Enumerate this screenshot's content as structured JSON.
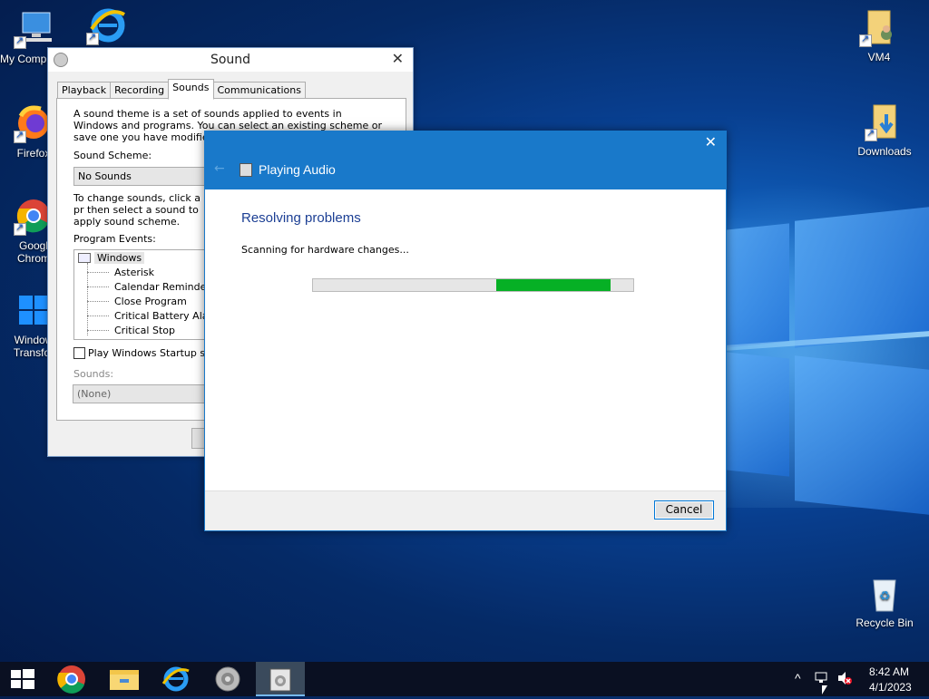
{
  "desktop": {
    "icons": [
      {
        "label": "My Comp",
        "icon": "computer-icon"
      },
      {
        "label": "",
        "icon": "internet-explorer-icon"
      },
      {
        "label": "Firefox",
        "icon": "firefox-icon"
      },
      {
        "label": "Googl\nChrom",
        "icon": "chrome-icon"
      },
      {
        "label": "Window\nTransfor",
        "icon": "windows-logo-icon"
      },
      {
        "label": "VM4",
        "icon": "user-folder-icon"
      },
      {
        "label": "Downloads",
        "icon": "downloads-folder-icon"
      },
      {
        "label": "Recycle Bin",
        "icon": "recycle-bin-icon"
      }
    ]
  },
  "sound_dialog": {
    "title": "Sound",
    "tabs": [
      "Playback",
      "Recording",
      "Sounds",
      "Communications"
    ],
    "active_tab": "Sounds",
    "intro": "A sound theme is a set of sounds applied to events in Windows and programs.  You can select an existing scheme or save one you have modified.",
    "scheme_label": "Sound Scheme:",
    "scheme_value": "No Sounds",
    "change_text": "To change sounds, click a pr then select a sound to apply sound scheme.",
    "events_label": "Program Events:",
    "events_root": "Windows",
    "events": [
      "Asterisk",
      "Calendar Reminder",
      "Close Program",
      "Critical Battery Alarm",
      "Critical Stop"
    ],
    "startup_label": "Play Windows Startup so",
    "sounds_label": "Sounds:",
    "sounds_value": "(None)"
  },
  "troubleshooter": {
    "title": "Playing Audio",
    "heading": "Resolving problems",
    "status": "Scanning for hardware changes...",
    "cancel_label": "Cancel",
    "progress_color": "#06b025"
  },
  "taskbar": {
    "items": [
      "start-icon",
      "chrome-icon",
      "file-explorer-icon",
      "internet-explorer-icon",
      "sound-icon",
      "troubleshooter-icon"
    ],
    "time": "8:42 AM",
    "date": "4/1/2023"
  }
}
